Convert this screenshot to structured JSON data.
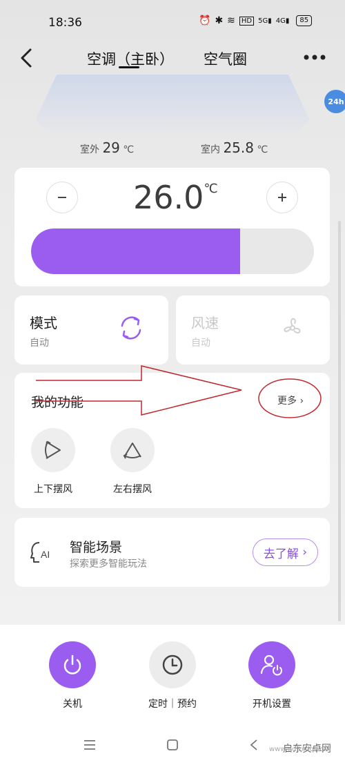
{
  "status_bar": {
    "time": "18:36",
    "battery": "85"
  },
  "nav": {
    "tabs": [
      "空调（主卧）",
      "空气圈"
    ]
  },
  "badge": "24h",
  "temps": {
    "outdoor_label": "室外",
    "outdoor_value": "29",
    "outdoor_unit": "℃",
    "indoor_label": "室内",
    "indoor_value": "25.8",
    "indoor_unit": "℃"
  },
  "temperature": {
    "value": "26.0",
    "unit": "℃",
    "slider_level": 0.74
  },
  "mode": {
    "title": "模式",
    "value": "自动"
  },
  "fan": {
    "title": "风速",
    "value": "自动"
  },
  "functions": {
    "title": "我的功能",
    "more": "更多",
    "items": [
      {
        "label": "上下摆风"
      },
      {
        "label": "左右摆风"
      }
    ]
  },
  "scene": {
    "title": "智能场景",
    "subtitle": "探索更多智能玩法",
    "button": "去了解"
  },
  "actions": [
    {
      "label": "关机"
    },
    {
      "label": "定时｜预约"
    },
    {
      "label": "开机设置"
    }
  ],
  "watermark": {
    "name": "启东安卓网",
    "url": "www.qdltxdq.com"
  },
  "colors": {
    "accent": "#9b5cf0",
    "annotation": "#c0272d"
  }
}
